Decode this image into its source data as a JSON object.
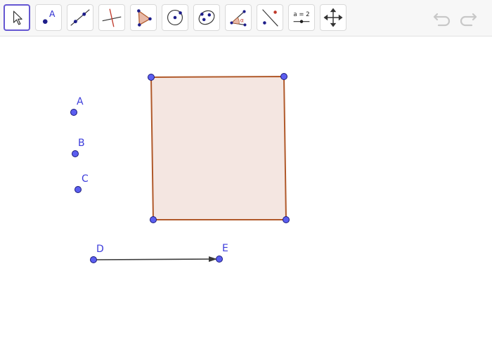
{
  "toolbar": {
    "tools": [
      {
        "name": "move-tool",
        "icon": "cursor-arrow-icon",
        "active": true
      },
      {
        "name": "point-tool",
        "icon": "point-icon",
        "label": "A"
      },
      {
        "name": "line-tool",
        "icon": "line-through-two-points-icon"
      },
      {
        "name": "perpendicular-line-tool",
        "icon": "perpendicular-line-icon"
      },
      {
        "name": "polygon-tool",
        "icon": "polygon-icon"
      },
      {
        "name": "circle-center-point-tool",
        "icon": "circle-with-center-icon"
      },
      {
        "name": "ellipse-tool",
        "icon": "ellipse-icon"
      },
      {
        "name": "angle-tool",
        "icon": "angle-icon",
        "label": "α"
      },
      {
        "name": "reflect-about-line-tool",
        "icon": "reflect-about-line-icon"
      },
      {
        "name": "slider-tool",
        "icon": "slider-icon",
        "label": "a = 2"
      },
      {
        "name": "move-graphics-view-tool",
        "icon": "move-graphics-view-icon"
      }
    ],
    "undo_icon": "undo-icon",
    "redo_icon": "redo-icon"
  },
  "canvas": {
    "points": [
      {
        "id": "A",
        "label": "A"
      },
      {
        "id": "B",
        "label": "B"
      },
      {
        "id": "C",
        "label": "C"
      },
      {
        "id": "D",
        "label": "D"
      },
      {
        "id": "E",
        "label": "E"
      }
    ],
    "polygon": {
      "fill": "#f4e6e1",
      "stroke": "#b0592a"
    },
    "vector": {
      "from": "D",
      "to": "E",
      "color": "#3a3a3a"
    },
    "colors": {
      "point": "#5b5ef0",
      "label": "#3c3cdb",
      "accent": "#6557d2"
    }
  }
}
